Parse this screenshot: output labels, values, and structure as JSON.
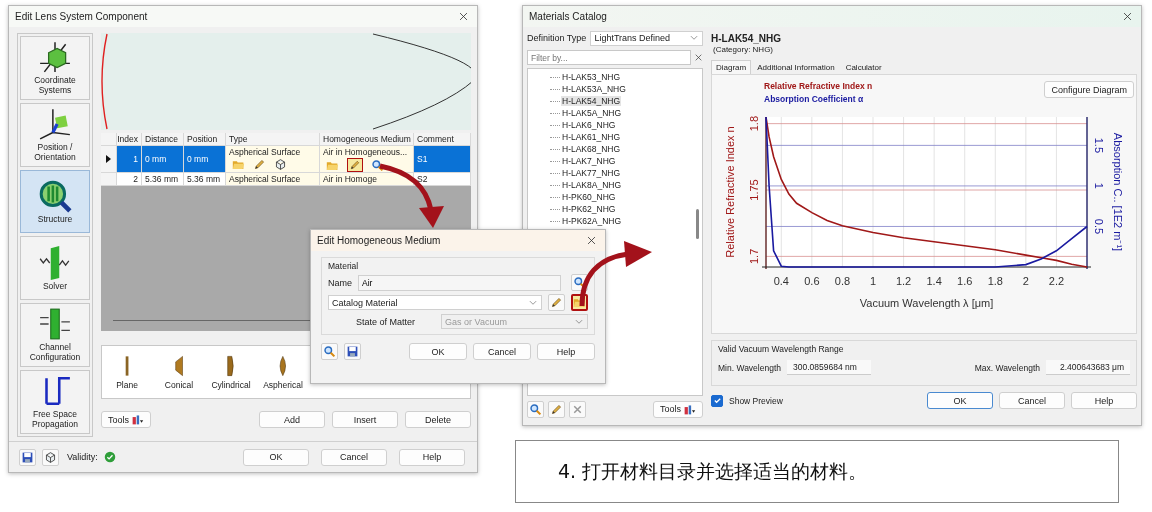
{
  "lens_dialog": {
    "title": "Edit Lens System Component",
    "sidebar": [
      {
        "label": "Coordinate Systems",
        "kind": "coordinates",
        "selected": false
      },
      {
        "label": "Position / Orientation",
        "kind": "position",
        "selected": false
      },
      {
        "label": "Structure",
        "kind": "structure",
        "selected": true
      },
      {
        "label": "Solver",
        "kind": "solver",
        "selected": false
      },
      {
        "label": "Channel Configuration",
        "kind": "channel",
        "selected": false
      },
      {
        "label": "Free Space Propagation",
        "kind": "propagation",
        "selected": false
      }
    ],
    "table": {
      "columns": [
        "Index",
        "Distance",
        "Position",
        "Type",
        "Homogeneous Medium",
        "Comment"
      ],
      "rows": [
        {
          "selected": true,
          "cells": [
            "1",
            "0 mm",
            "0 mm",
            "Aspherical Surface",
            "Air in Homogeneous...",
            "S1"
          ]
        },
        {
          "selected": false,
          "cells": [
            "2",
            "5.36 mm",
            "5.36 mm",
            "Aspherical Surface",
            "Air in Homoge",
            "S2"
          ]
        }
      ]
    },
    "surfaces": [
      {
        "label": "Plane",
        "kind": "plane"
      },
      {
        "label": "Conical",
        "kind": "conical"
      },
      {
        "label": "Cylindrical",
        "kind": "cylindrical"
      },
      {
        "label": "Aspherical",
        "kind": "aspherical"
      }
    ],
    "tools_button": "Tools",
    "actions": [
      "Add",
      "Insert",
      "Delete"
    ],
    "validity_label": "Validity:",
    "validity_ok": true,
    "buttons": [
      "OK",
      "Cancel",
      "Help"
    ]
  },
  "medium_dialog": {
    "title": "Edit Homogeneous Medium",
    "group": "Material",
    "name_label": "Name",
    "name_value": "Air",
    "source": "Catalog Material",
    "state_label": "State of Matter",
    "state_value": "Gas or Vacuum",
    "state_disabled": true,
    "buttons": [
      "OK",
      "Cancel",
      "Help"
    ]
  },
  "catalog": {
    "title": "Materials Catalog",
    "definition_type_label": "Definition Type",
    "definition_type": "LightTrans Defined",
    "filter_placeholder": "Filter by...",
    "materials": [
      {
        "name": "H-LAK53_NHG",
        "selected": false
      },
      {
        "name": "H-LAK53A_NHG",
        "selected": false
      },
      {
        "name": "H-LAK54_NHG",
        "selected": true
      },
      {
        "name": "H-LAK5A_NHG",
        "selected": false
      },
      {
        "name": "H-LAK6_NHG",
        "selected": false
      },
      {
        "name": "H-LAK61_NHG",
        "selected": false
      },
      {
        "name": "H-LAK68_NHG",
        "selected": false
      },
      {
        "name": "H-LAK7_NHG",
        "selected": false
      },
      {
        "name": "H-LAK77_NHG",
        "selected": false
      },
      {
        "name": "H-LAK8A_NHG",
        "selected": false
      },
      {
        "name": "H-PK60_NHG",
        "selected": false
      },
      {
        "name": "H-PK62_NHG",
        "selected": false
      },
      {
        "name": "H-PK62A_NHG",
        "selected": false
      }
    ],
    "material_name": "H-LAK54_NHG",
    "category": "(Category: NHG)",
    "tabs": [
      {
        "label": "Diagram",
        "selected": true
      },
      {
        "label": "Additional Information",
        "selected": false
      },
      {
        "label": "Calculator",
        "selected": false
      }
    ],
    "configure_button": "Configure Diagram",
    "chart_data": {
      "type": "line",
      "xlabel": "Vacuum Wavelength λ [μm]",
      "ylabel": "Relative Refractive Index n",
      "y2label": "Absorption C.. [1E2 m⁻¹]",
      "x": [
        0.3,
        0.32,
        0.35,
        0.4,
        0.45,
        0.5,
        0.6,
        0.7,
        0.8,
        1,
        1.2,
        1.4,
        1.6,
        1.8,
        2,
        2.1,
        2.2,
        2.3,
        2.4
      ],
      "series": [
        {
          "name": "Relative Refractive Index n",
          "color": "#a01818",
          "values": [
            1.805,
            1.79,
            1.775,
            1.758,
            1.747,
            1.74,
            1.733,
            1.727,
            1.723,
            1.718,
            1.714,
            1.711,
            1.708,
            1.705,
            1.701,
            1.699,
            1.697,
            1.694,
            1.692
          ]
        },
        {
          "name": "Absorption Coefficient α",
          "color": "#1a1aa0",
          "axis": "y2",
          "values": [
            1.85,
            1.0,
            0.2,
            0.01,
            0,
            0,
            0,
            0,
            0,
            0,
            0,
            0,
            0,
            0,
            0.03,
            0.1,
            0.2,
            0.35,
            0.5
          ]
        }
      ],
      "grid": true,
      "xlim": [
        0.3,
        2.4
      ],
      "ylim": [
        1.692,
        1.805
      ],
      "y2lim": [
        0,
        1.85
      ],
      "xticks": [
        0.4,
        0.6,
        0.8,
        1,
        1.2,
        1.4,
        1.6,
        1.8,
        2,
        2.2
      ],
      "yticks": [
        1.7,
        1.75,
        1.8
      ],
      "y2ticks": [
        0.5,
        1,
        1.5
      ]
    },
    "range_title": "Valid Vacuum Wavelength Range",
    "min_label": "Min. Wavelength",
    "min_value": "300.0859684 nm",
    "max_label": "Max. Wavelength",
    "max_value": "2.400643683 μm",
    "tools_button": "Tools",
    "show_preview": {
      "label": "Show Preview",
      "checked": true
    },
    "buttons": [
      "OK",
      "Cancel",
      "Help"
    ]
  },
  "caption": "4. 打开材料目录并选择适当的材料。"
}
